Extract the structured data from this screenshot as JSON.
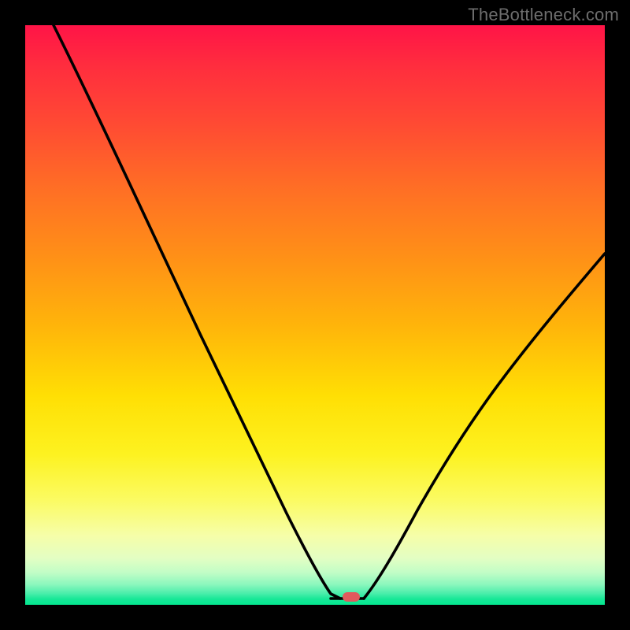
{
  "watermark": "TheBottleneck.com",
  "marker": {
    "x_pct": 56.2,
    "y_pct": 98.6
  },
  "chart_data": {
    "type": "line",
    "title": "",
    "xlabel": "",
    "ylabel": "",
    "xlim": [
      0,
      100
    ],
    "ylim": [
      0,
      100
    ],
    "legend": false,
    "grid": false,
    "annotations": [
      "TheBottleneck.com"
    ],
    "background_gradient": [
      "#ff1447",
      "#ffdf04",
      "#04e890"
    ],
    "series": [
      {
        "name": "curve",
        "x": [
          5,
          10,
          15,
          20,
          25,
          30,
          35,
          40,
          45,
          50,
          54,
          56,
          58,
          60,
          65,
          70,
          75,
          80,
          85,
          90,
          95,
          100
        ],
        "y": [
          100,
          90,
          80.5,
          71.5,
          63,
          54,
          44,
          34,
          23,
          11,
          2,
          1,
          1,
          3,
          11,
          20,
          29,
          37,
          44,
          50,
          56,
          61
        ]
      }
    ],
    "flat_segment": {
      "x_start": 52,
      "x_end": 58,
      "y": 1
    },
    "marker_point": {
      "x": 56.2,
      "y": 1.4
    }
  }
}
